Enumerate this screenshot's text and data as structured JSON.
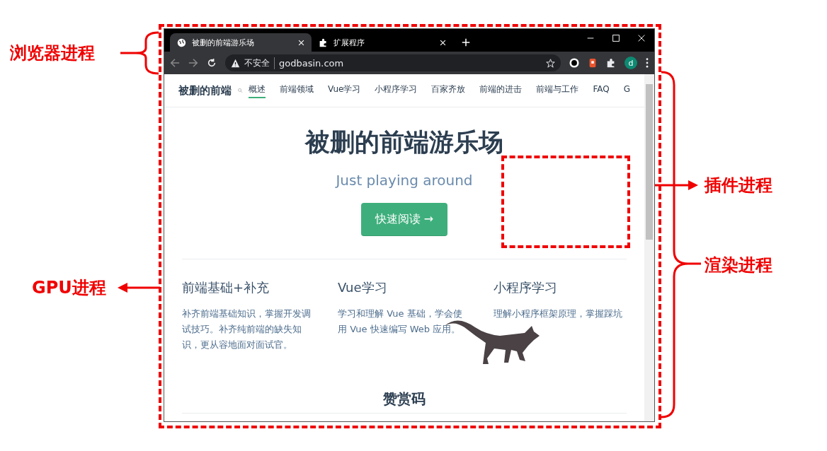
{
  "annotations": [
    {
      "label": "浏览器进程",
      "kind": "brace-left"
    },
    {
      "label": "GPU进程",
      "kind": "arrow-left"
    },
    {
      "label": "插件进程",
      "kind": "arrow-right"
    },
    {
      "label": "渲染进程",
      "kind": "brace-right"
    }
  ],
  "browser": {
    "tabs": [
      {
        "title": "被删的前端游乐场",
        "kind": "globe",
        "selected": true
      },
      {
        "title": "扩展程序",
        "kind": "puzzle",
        "selected": false
      }
    ],
    "address": {
      "security": "不安全",
      "url": "godbasin.com"
    },
    "profile_initial": "d"
  },
  "page": {
    "site_title": "被删的前端",
    "nav": [
      {
        "label": "概述",
        "selected": true
      },
      {
        "label": "前端领域",
        "selected": false
      },
      {
        "label": "Vue学习",
        "selected": false
      },
      {
        "label": "小程序学习",
        "selected": false
      },
      {
        "label": "百家齐放",
        "selected": false
      },
      {
        "label": "前端的进击",
        "selected": false
      },
      {
        "label": "前端与工作",
        "selected": false
      },
      {
        "label": "FAQ",
        "selected": false
      },
      {
        "label": "G",
        "selected": false
      }
    ],
    "hero": {
      "title": "被删的前端游乐场",
      "subtitle": "Just playing around",
      "button": "快速阅读 →"
    },
    "features": [
      {
        "title": "前端基础+补充",
        "description": "补齐前端基础知识，掌握开发调试技巧。补齐纯前端的缺失知识，更从容地面对面试官。"
      },
      {
        "title": "Vue学习",
        "description": "学习和理解 Vue 基础，学会使用 Vue 快速编写 Web 应用。"
      },
      {
        "title": "小程序学习",
        "description": "理解小程序框架原理，掌握踩坑"
      }
    ],
    "section_title": "赞赏码"
  }
}
